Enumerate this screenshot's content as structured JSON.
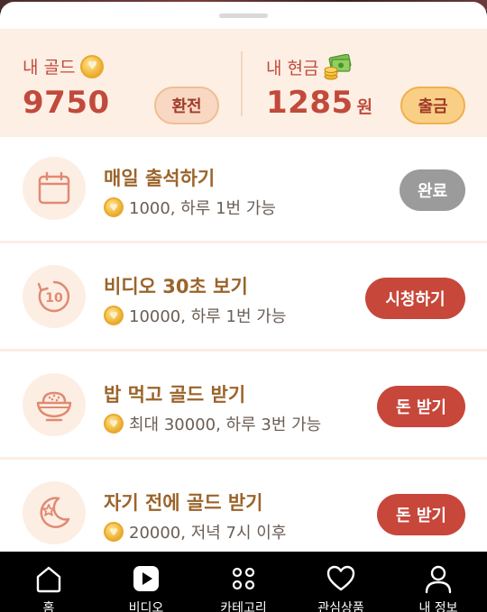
{
  "wallet": {
    "gold_label": "내 골드",
    "gold_value": "9750",
    "exchange_button": "환전",
    "cash_label": "내 현금",
    "cash_value": "1285",
    "cash_unit": "원",
    "withdraw_button": "출금"
  },
  "tasks": [
    {
      "title": "매일 출석하기",
      "reward": "1000, 하루 1번 가능",
      "button": "완료",
      "icon": "calendar-icon",
      "button_state": "completed"
    },
    {
      "title": "비디오 30초 보기",
      "reward": "10000, 하루 1번 가능",
      "button": "시청하기",
      "icon": "replay-10-icon",
      "button_state": "active"
    },
    {
      "title": "밥 먹고 골드 받기",
      "reward": "최대 30000, 하루 3번 가능",
      "button": "돈 받기",
      "icon": "rice-bowl-icon",
      "button_state": "active"
    },
    {
      "title": "자기 전에 골드 받기",
      "reward": "20000, 저녁 7시 이후",
      "button": "돈 받기",
      "icon": "moon-star-icon",
      "button_state": "active"
    }
  ],
  "nav": [
    {
      "label": "홈",
      "icon": "home-icon"
    },
    {
      "label": "비디오",
      "icon": "video-play-icon",
      "active": true
    },
    {
      "label": "카테고리",
      "icon": "category-grid-icon"
    },
    {
      "label": "관심상품",
      "icon": "heart-icon"
    },
    {
      "label": "내 정보",
      "icon": "user-icon"
    }
  ],
  "colors": {
    "accent_red": "#c7473b",
    "title_brown": "#9b642a",
    "wallet_bg": "#fdefe4",
    "icon_bg": "#fdeee4",
    "done_gray": "#9b9b9b"
  }
}
